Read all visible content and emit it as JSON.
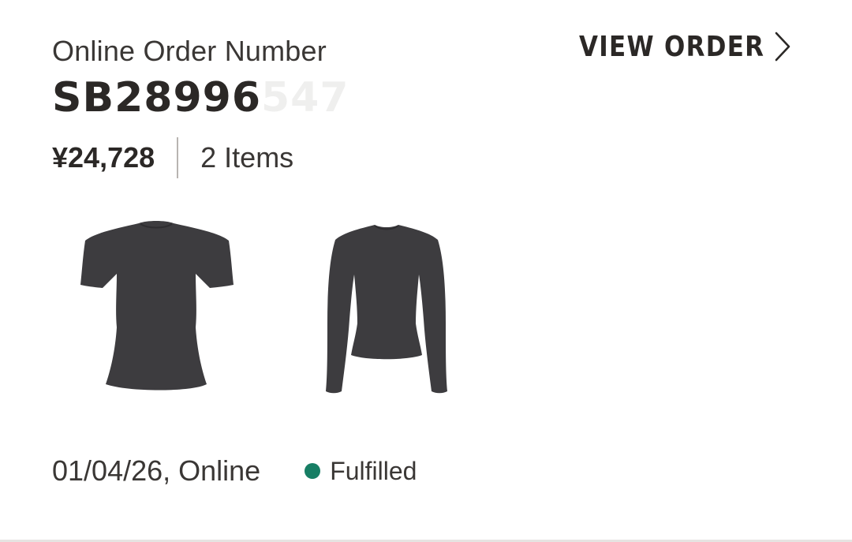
{
  "order": {
    "label": "Online Order Number",
    "number_visible": "SB28996",
    "number_faded": "547",
    "price": "¥24,728",
    "item_count": "2 Items",
    "view_order_label": "VIEW ORDER",
    "date_channel": "01/04/26, Online",
    "status": "Fulfilled"
  },
  "products": [
    {
      "icon": "short-sleeve-tshirt"
    },
    {
      "icon": "long-sleeve-top"
    }
  ],
  "colors": {
    "text_primary": "#2b2826",
    "garment": "#3d3c3f",
    "status_fulfilled": "#177e64",
    "divider": "#b8b4b1"
  }
}
